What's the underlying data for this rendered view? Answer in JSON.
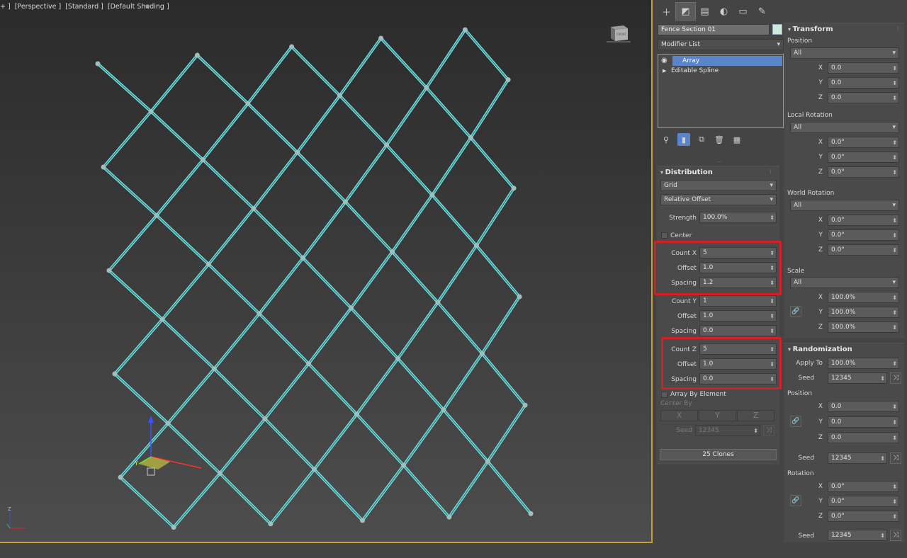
{
  "viewport": {
    "labels": [
      "+ ]",
      "[Perspective ]",
      "[Standard ]",
      "[Default Shading ]"
    ],
    "viewcube_label": "FRONT",
    "mesh_color": "#6fdcdc"
  },
  "command_panel": {
    "tabs": [
      "create-icon",
      "modify-icon",
      "hierarchy-icon",
      "motion-icon",
      "display-icon",
      "utilities-icon"
    ],
    "object_name": "Fence Section 01",
    "object_color": "#cde9de",
    "modifier_list": "Modifier List",
    "stack": [
      {
        "label": "Array",
        "selected": true
      },
      {
        "label": "Editable Spline",
        "selected": false
      }
    ],
    "distribution": {
      "header": "Distribution",
      "type": "Grid",
      "offset_mode": "Relative Offset",
      "strength_label": "Strength",
      "strength": "100.0%",
      "center_label": "Center",
      "count_x_label": "Count X",
      "count_x": "5",
      "offset_x_label": "Offset",
      "offset_x": "1.0",
      "spacing_x_label": "Spacing",
      "spacing_x": "1.2",
      "count_y_label": "Count Y",
      "count_y": "1",
      "offset_y_label": "Offset",
      "offset_y": "1.0",
      "spacing_y_label": "Spacing",
      "spacing_y": "0.0",
      "count_z_label": "Count Z",
      "count_z": "5",
      "offset_z_label": "Offset",
      "offset_z": "1.0",
      "spacing_z_label": "Spacing",
      "spacing_z": "0.0",
      "array_by_element": "Array By Element",
      "center_by": "Center By",
      "axis_x": "X",
      "axis_y": "Y",
      "axis_z": "Z",
      "seed_label": "Seed",
      "seed": "12345",
      "clones": "25 Clones"
    },
    "transform": {
      "header": "Transform",
      "position_label": "Position",
      "position_mode": "All",
      "pos_x": "0.0",
      "pos_y": "0.0",
      "pos_z": "0.0",
      "local_rotation_label": "Local Rotation",
      "local_rotation_mode": "All",
      "lrot_x": "0.0°",
      "lrot_y": "0.0°",
      "lrot_z": "0.0°",
      "world_rotation_label": "World Rotation",
      "world_rotation_mode": "All",
      "wrot_x": "0.0°",
      "wrot_y": "0.0°",
      "wrot_z": "0.0°",
      "scale_label": "Scale",
      "scale_mode": "All",
      "scl_x": "100.0%",
      "scl_y": "100.0%",
      "scl_z": "100.0%"
    },
    "randomization": {
      "header": "Randomization",
      "apply_to_label": "Apply To",
      "apply_to": "100.0%",
      "seed_label": "Seed",
      "seed": "12345",
      "position_label": "Position",
      "pos_x": "0.0",
      "pos_y": "0.0",
      "pos_z": "0.0",
      "pos_seed": "12345",
      "rotation_label": "Rotation",
      "rot_x": "0.0°",
      "rot_y": "0.0°",
      "rot_z": "0.0°",
      "rot_seed": "12345"
    },
    "axis_labels": {
      "x": "X",
      "y": "Y",
      "z": "Z"
    }
  }
}
